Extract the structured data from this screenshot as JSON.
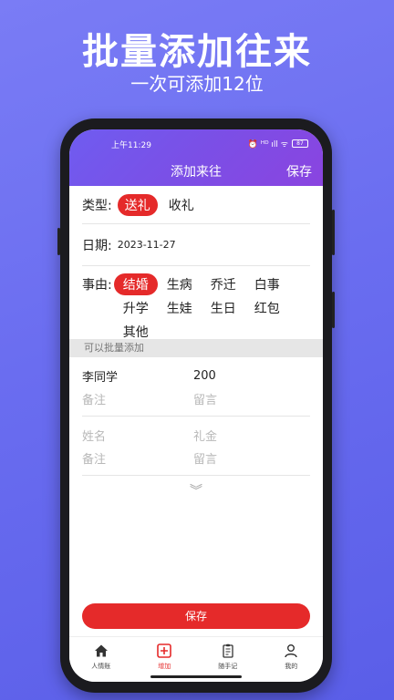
{
  "promo": {
    "title": "批量添加往来",
    "subtitle": "一次可添加12位"
  },
  "status": {
    "time": "上午11:29",
    "signal": "⏰ ᴴᴰ ıll ᯤ",
    "battery": "87"
  },
  "nav": {
    "title": "添加来往",
    "save": "保存"
  },
  "form": {
    "type_label": "类型:",
    "types": [
      "送礼",
      "收礼"
    ],
    "date_label": "日期:",
    "date_value": "2023-11-27",
    "reason_label": "事由:",
    "reasons": [
      "结婚",
      "生病",
      "乔迁",
      "白事",
      "升学",
      "生娃",
      "生日",
      "红包",
      "其他"
    ]
  },
  "batch": {
    "hint": "可以批量添加",
    "entries": [
      {
        "name": "李同学",
        "amount": "200",
        "note_ph": "备注",
        "message_ph": "留言"
      },
      {
        "name_ph": "姓名",
        "amount_ph": "礼金",
        "note_ph": "备注",
        "message_ph": "留言"
      }
    ],
    "expand": "︾"
  },
  "save_button": "保存",
  "tabs": [
    {
      "label": "人情账",
      "icon": "home-icon"
    },
    {
      "label": "增加",
      "icon": "add-icon"
    },
    {
      "label": "随手记",
      "icon": "note-icon"
    },
    {
      "label": "我的",
      "icon": "user-icon"
    }
  ],
  "colors": {
    "accent": "#e52a2a",
    "header_gradient_start": "#6f5cf0",
    "header_gradient_end": "#8a44e0"
  }
}
